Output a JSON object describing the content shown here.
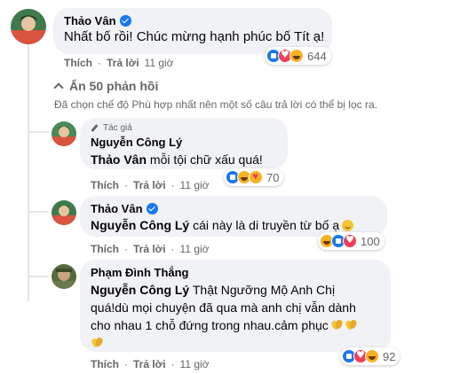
{
  "comment": {
    "author": "Thảo Vân",
    "text": "Nhất bố rồi! Chúc mừng hạnh phúc bố Tít ạ!",
    "like_label": "Thích",
    "reply_label": "Trả lời",
    "time": "11 giờ",
    "reaction_count": "644",
    "reaction_icons": [
      "like-icon",
      "love-icon",
      "haha-icon"
    ]
  },
  "replies_toggle": {
    "label": "Ẩn 50 phản hồi",
    "note": "Đã chọn chế độ Phù hợp nhất nên một số câu trả lời có thể bị lọc ra."
  },
  "replies": [
    {
      "author_badge": "Tác giả",
      "author": "Nguyễn Công Lý",
      "mention": "Thảo Vân",
      "text": "mỗi tội chữ xấu quá!",
      "like_label": "Thích",
      "reply_label": "Trả lời",
      "time": "11 giờ",
      "reaction_count": "70",
      "reaction_icons": [
        "like-icon",
        "haha-icon",
        "care-icon"
      ]
    },
    {
      "author": "Thảo Vân",
      "mention": "Nguyễn Công Lý",
      "text": "cái này là di truyền từ bố ạ",
      "like_label": "Thích",
      "reply_label": "Trả lời",
      "time": "11 giờ",
      "reaction_count": "100",
      "reaction_icons": [
        "haha-icon",
        "like-icon",
        "love-icon"
      ]
    },
    {
      "author": "Phạm Đình Thắng",
      "mention": "Nguyễn Công Lý",
      "text_line1": "Thật Ngưỡng Mộ Anh Chị",
      "text_line2": "quá!dù mọi chuyện đã qua mà anh chị vẫn dành",
      "text_line3": "cho nhau 1 chỗ đứng trong nhau.cảm phục",
      "like_label": "Thích",
      "reply_label": "Trả lời",
      "time": "11 giờ",
      "reaction_count": "92",
      "reaction_icons": [
        "like-icon",
        "love-icon",
        "haha-icon"
      ]
    }
  ],
  "colors": {
    "bubble": "#f0f2f5",
    "meta": "#65676b",
    "like_blue": "#1877f2",
    "love_red": "#f33e58"
  }
}
